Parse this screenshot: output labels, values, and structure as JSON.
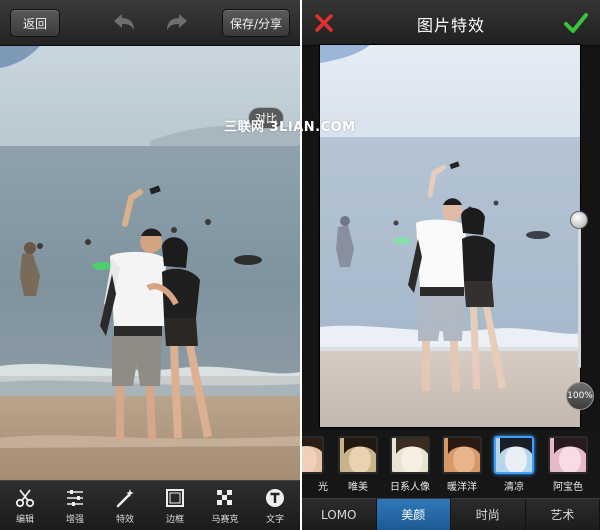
{
  "editor": {
    "back_label": "返回",
    "save_label": "保存/分享",
    "compare_label": "对比",
    "tools": [
      {
        "icon": "scissors-icon",
        "label": "编辑"
      },
      {
        "icon": "sliders-icon",
        "label": "增强"
      },
      {
        "icon": "magic-wand-icon",
        "label": "特效"
      },
      {
        "icon": "frame-icon",
        "label": "边框"
      },
      {
        "icon": "mosaic-icon",
        "label": "马赛克"
      },
      {
        "icon": "text-icon",
        "label": "文字"
      }
    ]
  },
  "effects": {
    "title": "图片特效",
    "strength_label": "100%",
    "strength_value": 100,
    "filters": [
      {
        "label": "光"
      },
      {
        "label": "唯美"
      },
      {
        "label": "日系人像"
      },
      {
        "label": "暖洋洋"
      },
      {
        "label": "清凉",
        "selected": true
      },
      {
        "label": "阿宝色"
      }
    ],
    "tabs": [
      {
        "label": "LOMO",
        "active": false
      },
      {
        "label": "美颜",
        "active": true
      },
      {
        "label": "时尚",
        "active": false
      },
      {
        "label": "艺术",
        "active": false
      }
    ]
  },
  "watermark": "三联网 3LIAN.COM",
  "colors": {
    "accent_blue": "#2e79b8",
    "confirm_green": "#3cc33c",
    "close_red": "#e03030"
  }
}
